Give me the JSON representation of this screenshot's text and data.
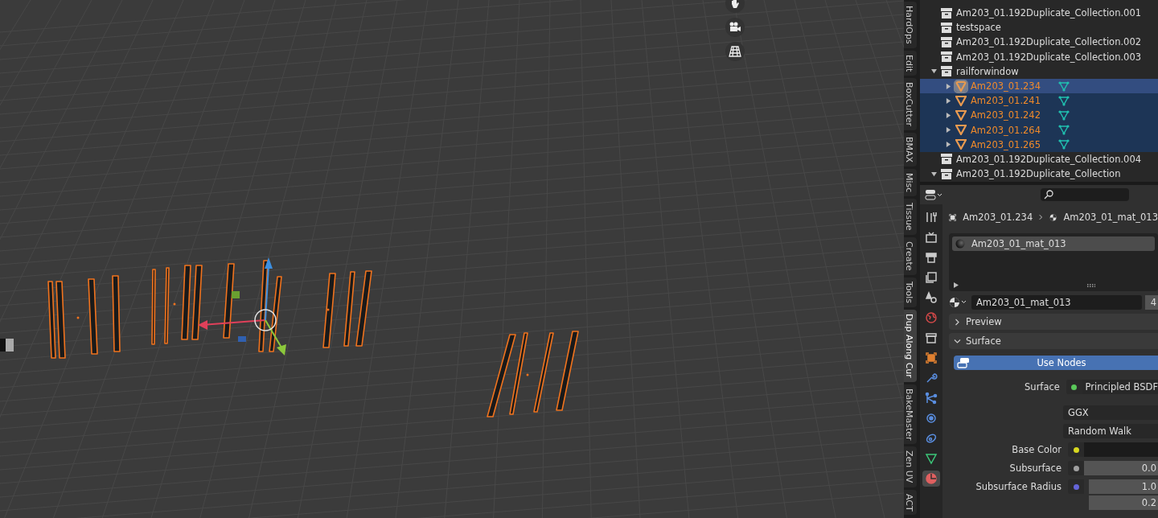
{
  "side_tabs": [
    {
      "label": "HardOps",
      "selected": false
    },
    {
      "label": "Edit",
      "selected": false
    },
    {
      "label": "BoxCutter",
      "selected": false
    },
    {
      "label": "BMAX",
      "selected": false
    },
    {
      "label": "Misc",
      "selected": false
    },
    {
      "label": "Tissue",
      "selected": false
    },
    {
      "label": "Create",
      "selected": false
    },
    {
      "label": "Tools",
      "selected": false
    },
    {
      "label": "Dup Along Cur",
      "selected": true
    },
    {
      "label": "BakeMaster",
      "selected": false
    },
    {
      "label": "Zen UV",
      "selected": false
    },
    {
      "label": "ACT",
      "selected": false
    }
  ],
  "outliner": {
    "items": [
      {
        "kind": "collection",
        "name": "Am203_01.192Duplicate_Collection.001",
        "selected": false
      },
      {
        "kind": "collection",
        "name": "testspace",
        "selected": false
      },
      {
        "kind": "collection",
        "name": "Am203_01.192Duplicate_Collection.002",
        "selected": false
      },
      {
        "kind": "collection",
        "name": "Am203_01.192Duplicate_Collection.003",
        "selected": false
      },
      {
        "kind": "collection",
        "name": "railforwindow",
        "selected": false,
        "expanded": true,
        "children": [
          {
            "kind": "object",
            "name": "Am203_01.234",
            "selected": true,
            "active": true,
            "expanded": false
          },
          {
            "kind": "object",
            "name": "Am203_01.241",
            "selected": true,
            "active": false,
            "expanded": false
          },
          {
            "kind": "object",
            "name": "Am203_01.242",
            "selected": true,
            "active": false,
            "expanded": false
          },
          {
            "kind": "object",
            "name": "Am203_01.264",
            "selected": true,
            "active": false,
            "expanded": false
          },
          {
            "kind": "object",
            "name": "Am203_01.265",
            "selected": true,
            "active": false,
            "expanded": false
          }
        ]
      },
      {
        "kind": "collection",
        "name": "Am203_01.192Duplicate_Collection.004",
        "selected": false
      },
      {
        "kind": "collection",
        "name": "Am203_01.192Duplicate_Collection",
        "selected": false,
        "expanded": true
      }
    ]
  },
  "properties": {
    "tabs": [
      {
        "kind": "tool",
        "selected": false
      },
      {
        "kind": "render",
        "selected": false
      },
      {
        "kind": "output",
        "selected": false
      },
      {
        "kind": "view_layer",
        "selected": false
      },
      {
        "kind": "scene",
        "selected": false
      },
      {
        "kind": "world",
        "selected": false
      },
      {
        "kind": "collection",
        "selected": false
      },
      {
        "kind": "object",
        "selected": false
      },
      {
        "kind": "modifiers",
        "selected": false
      },
      {
        "kind": "particles",
        "selected": false
      },
      {
        "kind": "physics",
        "selected": false
      },
      {
        "kind": "constraints",
        "selected": false
      },
      {
        "kind": "data",
        "selected": false
      },
      {
        "kind": "material",
        "selected": true
      }
    ],
    "breadcrumb": [
      "Am203_01.234",
      "Am203_01_mat_013"
    ],
    "slots": [
      {
        "name": "Am203_01_mat_013",
        "selected": true
      }
    ],
    "material_field": {
      "value": "Am203_01_mat_013",
      "users": "4"
    },
    "panels": [
      {
        "title": "Preview",
        "expanded": false
      },
      {
        "title": "Surface",
        "expanded": true
      }
    ],
    "use_nodes": {
      "label": "Use Nodes",
      "on": true
    },
    "rows": [
      {
        "kind": "socket",
        "label": "Surface",
        "color": "#5ac85a",
        "values": [
          "Principled BSDF"
        ]
      },
      {
        "kind": "dropdown",
        "values": [
          "GGX"
        ]
      },
      {
        "kind": "dropdown",
        "values": [
          "Random Walk"
        ]
      },
      {
        "kind": "color",
        "label": "Base Color",
        "color": "#d8d820"
      },
      {
        "kind": "number",
        "label": "Subsurface",
        "color": "#a0a0a0",
        "values": [
          "0.0"
        ]
      },
      {
        "kind": "number",
        "label": "Subsurface Radius",
        "color": "#6464d8",
        "values": [
          "1.0",
          "0.2"
        ]
      }
    ]
  }
}
